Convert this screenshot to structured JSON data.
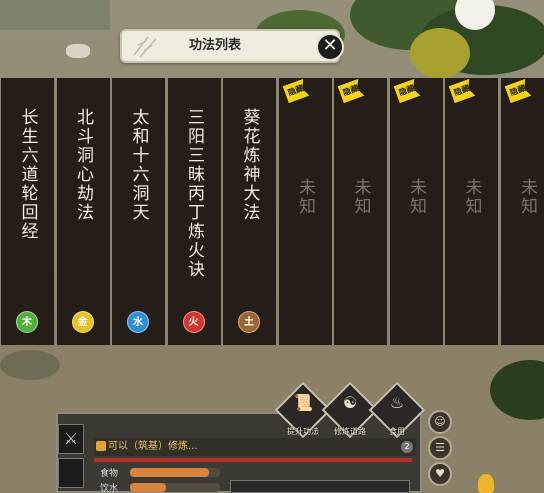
{
  "window": {
    "title": "功法列表"
  },
  "techniques": [
    {
      "name": "长生六道轮回经",
      "element": "木",
      "element_color": "#4fae3c",
      "known": true
    },
    {
      "name": "北斗洞心劫法",
      "element": "金",
      "element_color": "#e5c21f",
      "known": true
    },
    {
      "name": "太和十六洞天",
      "element": "水",
      "element_color": "#2f8fd6",
      "known": true
    },
    {
      "name": "三阳三昧丙丁炼火诀",
      "element": "火",
      "element_color": "#d6352d",
      "known": true
    },
    {
      "name": "葵花炼神大法",
      "element": "土",
      "element_color": "#9a6732",
      "known": true
    },
    {
      "name": "未知",
      "hidden_tag": "隐藏",
      "known": false
    },
    {
      "name": "未知",
      "hidden_tag": "隐藏",
      "known": false
    },
    {
      "name": "未知",
      "hidden_tag": "隐藏",
      "known": false
    },
    {
      "name": "未知",
      "hidden_tag": "隐藏",
      "known": false
    },
    {
      "name": "未知",
      "hidden_tag": "隐藏",
      "known": false
    }
  ],
  "hud": {
    "skills": [
      {
        "label": "提升功法",
        "icon": "scroll-icon"
      },
      {
        "label": "修炼道路",
        "icon": "meditate-icon"
      },
      {
        "label": "食用",
        "icon": "eat-icon"
      }
    ],
    "status_text": "可以（筑基）修炼...",
    "notice_count": "2",
    "bars": [
      {
        "label": "食物",
        "fill": 0.88
      },
      {
        "label": "饮水",
        "fill": 0.4
      }
    ]
  },
  "colors": {
    "card_bg": "#241d18",
    "hidden_tag": "#f2d21b",
    "banner_bg": "#efecdf"
  }
}
